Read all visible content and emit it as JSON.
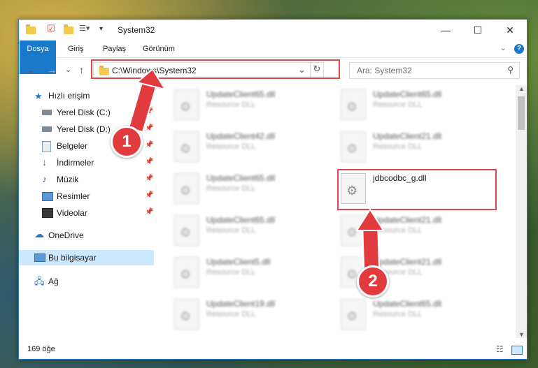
{
  "window": {
    "title": "System32"
  },
  "window_controls": {
    "minimize": "—",
    "maximize": "☐",
    "close": "✕"
  },
  "ribbon": {
    "tabs": [
      "Dosya",
      "Giriş",
      "Paylaş",
      "Görünüm"
    ],
    "help": "?"
  },
  "nav": {
    "back": "←",
    "forward": "→",
    "recent": "⌄",
    "up": "↑"
  },
  "address": {
    "path": "C:\\Windows\\System32",
    "dropdown": "⌄",
    "refresh": "↻"
  },
  "search": {
    "placeholder": "Ara: System32"
  },
  "sidebar": {
    "items": [
      {
        "label": "Hızlı erişim",
        "icon": "star-icon"
      },
      {
        "label": "Yerel Disk (C:)",
        "icon": "drive-icon",
        "pinned": true
      },
      {
        "label": "Yerel Disk (D:)",
        "icon": "drive-icon",
        "pinned": true
      },
      {
        "label": "Belgeler",
        "icon": "document-icon",
        "pinned": true
      },
      {
        "label": "İndirmeler",
        "icon": "download-icon",
        "pinned": true
      },
      {
        "label": "Müzik",
        "icon": "music-icon",
        "pinned": true
      },
      {
        "label": "Resimler",
        "icon": "picture-icon",
        "pinned": true
      },
      {
        "label": "Videolar",
        "icon": "video-icon",
        "pinned": true
      },
      {
        "label": "OneDrive",
        "icon": "cloud-icon"
      },
      {
        "label": "Bu bilgisayar",
        "icon": "computer-icon",
        "selected": true
      },
      {
        "label": "Ağ",
        "icon": "network-icon"
      }
    ]
  },
  "files": [
    {
      "name": "UpdateClient65.dll",
      "type": "Resource DLL"
    },
    {
      "name": "UpdateClient65.dll",
      "type": "Resource DLL"
    },
    {
      "name": "UpdateClient42.dll",
      "type": "Resource DLL"
    },
    {
      "name": "UpdateClient21.dll",
      "type": "Resource DLL"
    },
    {
      "name": "UpdateClient65.dll",
      "type": "Resource DLL"
    },
    {
      "name": "jdbcodbc_g.dll",
      "type": "",
      "highlighted": true
    },
    {
      "name": "UpdateClient65.dll",
      "type": "Resource DLL"
    },
    {
      "name": "UpdateClient21.dll",
      "type": "Resource DLL"
    },
    {
      "name": "UpdateClient5.dll",
      "type": "Resource DLL"
    },
    {
      "name": "UpdateClient21.dll",
      "type": "Resource DLL"
    },
    {
      "name": "UpdateClient19.dll",
      "type": "Resource DLL"
    },
    {
      "name": "UpdateClient65.dll",
      "type": "Resource DLL"
    }
  ],
  "status": {
    "count": "169 öğe"
  },
  "callouts": {
    "one": "1",
    "two": "2"
  },
  "colors": {
    "accent": "#1979ca",
    "annotation": "#d9484a",
    "selection": "#cce8ff"
  }
}
